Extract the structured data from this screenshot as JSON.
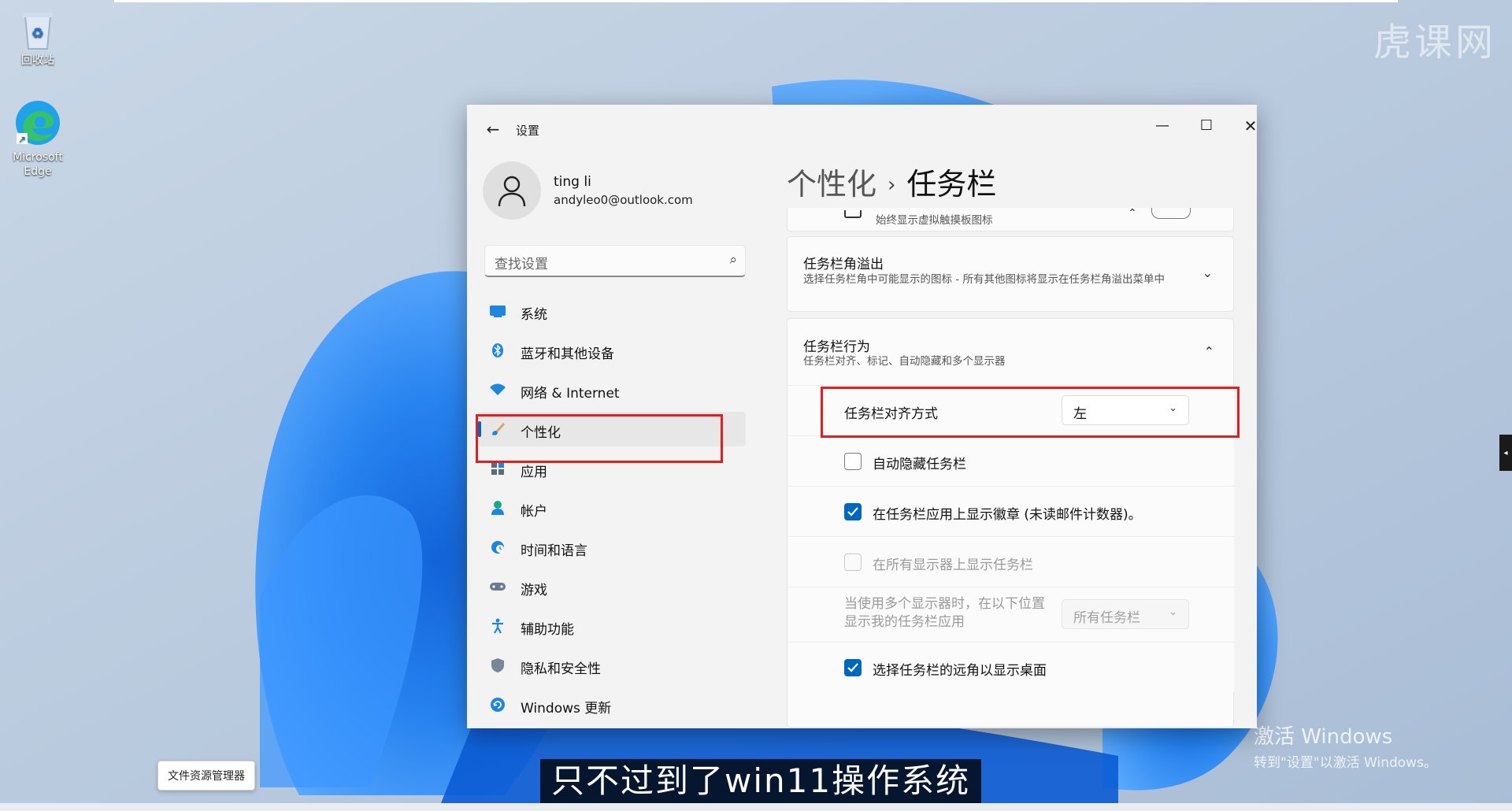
{
  "desktop": {
    "icons": [
      {
        "label": "回收站"
      },
      {
        "label": "Microsoft Edge"
      }
    ],
    "watermark": "虎课网",
    "activate_title": "激活 Windows",
    "activate_sub": "转到\"设置\"以激活 Windows。",
    "explorer_tooltip": "文件资源管理器",
    "subtitle": "只不过到了win11操作系统"
  },
  "window": {
    "title": "设置",
    "controls": {
      "minimize": "—",
      "maximize": "☐",
      "close": "✕"
    }
  },
  "user": {
    "name": "ting li",
    "email": "andyleo0@outlook.com"
  },
  "search": {
    "placeholder": "查找设置"
  },
  "nav": [
    {
      "label": "系统",
      "icon": "monitor-icon"
    },
    {
      "label": "蓝牙和其他设备",
      "icon": "bluetooth-icon"
    },
    {
      "label": "网络 & Internet",
      "icon": "wifi-icon"
    },
    {
      "label": "个性化",
      "icon": "brush-icon",
      "active": true
    },
    {
      "label": "应用",
      "icon": "apps-icon"
    },
    {
      "label": "帐户",
      "icon": "person-icon"
    },
    {
      "label": "时间和语言",
      "icon": "globe-clock-icon"
    },
    {
      "label": "游戏",
      "icon": "gamepad-icon"
    },
    {
      "label": "辅助功能",
      "icon": "accessibility-icon"
    },
    {
      "label": "隐私和安全性",
      "icon": "shield-icon"
    },
    {
      "label": "Windows 更新",
      "icon": "update-icon"
    }
  ],
  "breadcrumb": {
    "parent": "个性化",
    "separator": "›",
    "current": "任务栏"
  },
  "content": {
    "partial_row_desc": "始终显示虚拟触摸板图标",
    "overflow": {
      "title": "任务栏角溢出",
      "desc": "选择任务栏角中可能显示的图标 - 所有其他图标将显示在任务栏角溢出菜单中"
    },
    "behavior": {
      "title": "任务栏行为",
      "desc": "任务栏对齐、标记、自动隐藏和多个显示器"
    },
    "alignment": {
      "label": "任务栏对齐方式",
      "value": "左"
    },
    "auto_hide": {
      "label": "自动隐藏任务栏",
      "checked": false
    },
    "badges": {
      "label": "在任务栏应用上显示徽章 (未读邮件计数器)。",
      "checked": true
    },
    "all_displays": {
      "label": "在所有显示器上显示任务栏",
      "checked": false,
      "disabled": true
    },
    "multi_display": {
      "label": "当使用多个显示器时，在以下位置显示我的任务栏应用",
      "value": "所有任务栏"
    },
    "far_corner": {
      "label": "选择任务栏的远角以显示桌面",
      "checked": true
    }
  },
  "colors": {
    "accent": "#0067c0",
    "highlight": "#e02020"
  }
}
